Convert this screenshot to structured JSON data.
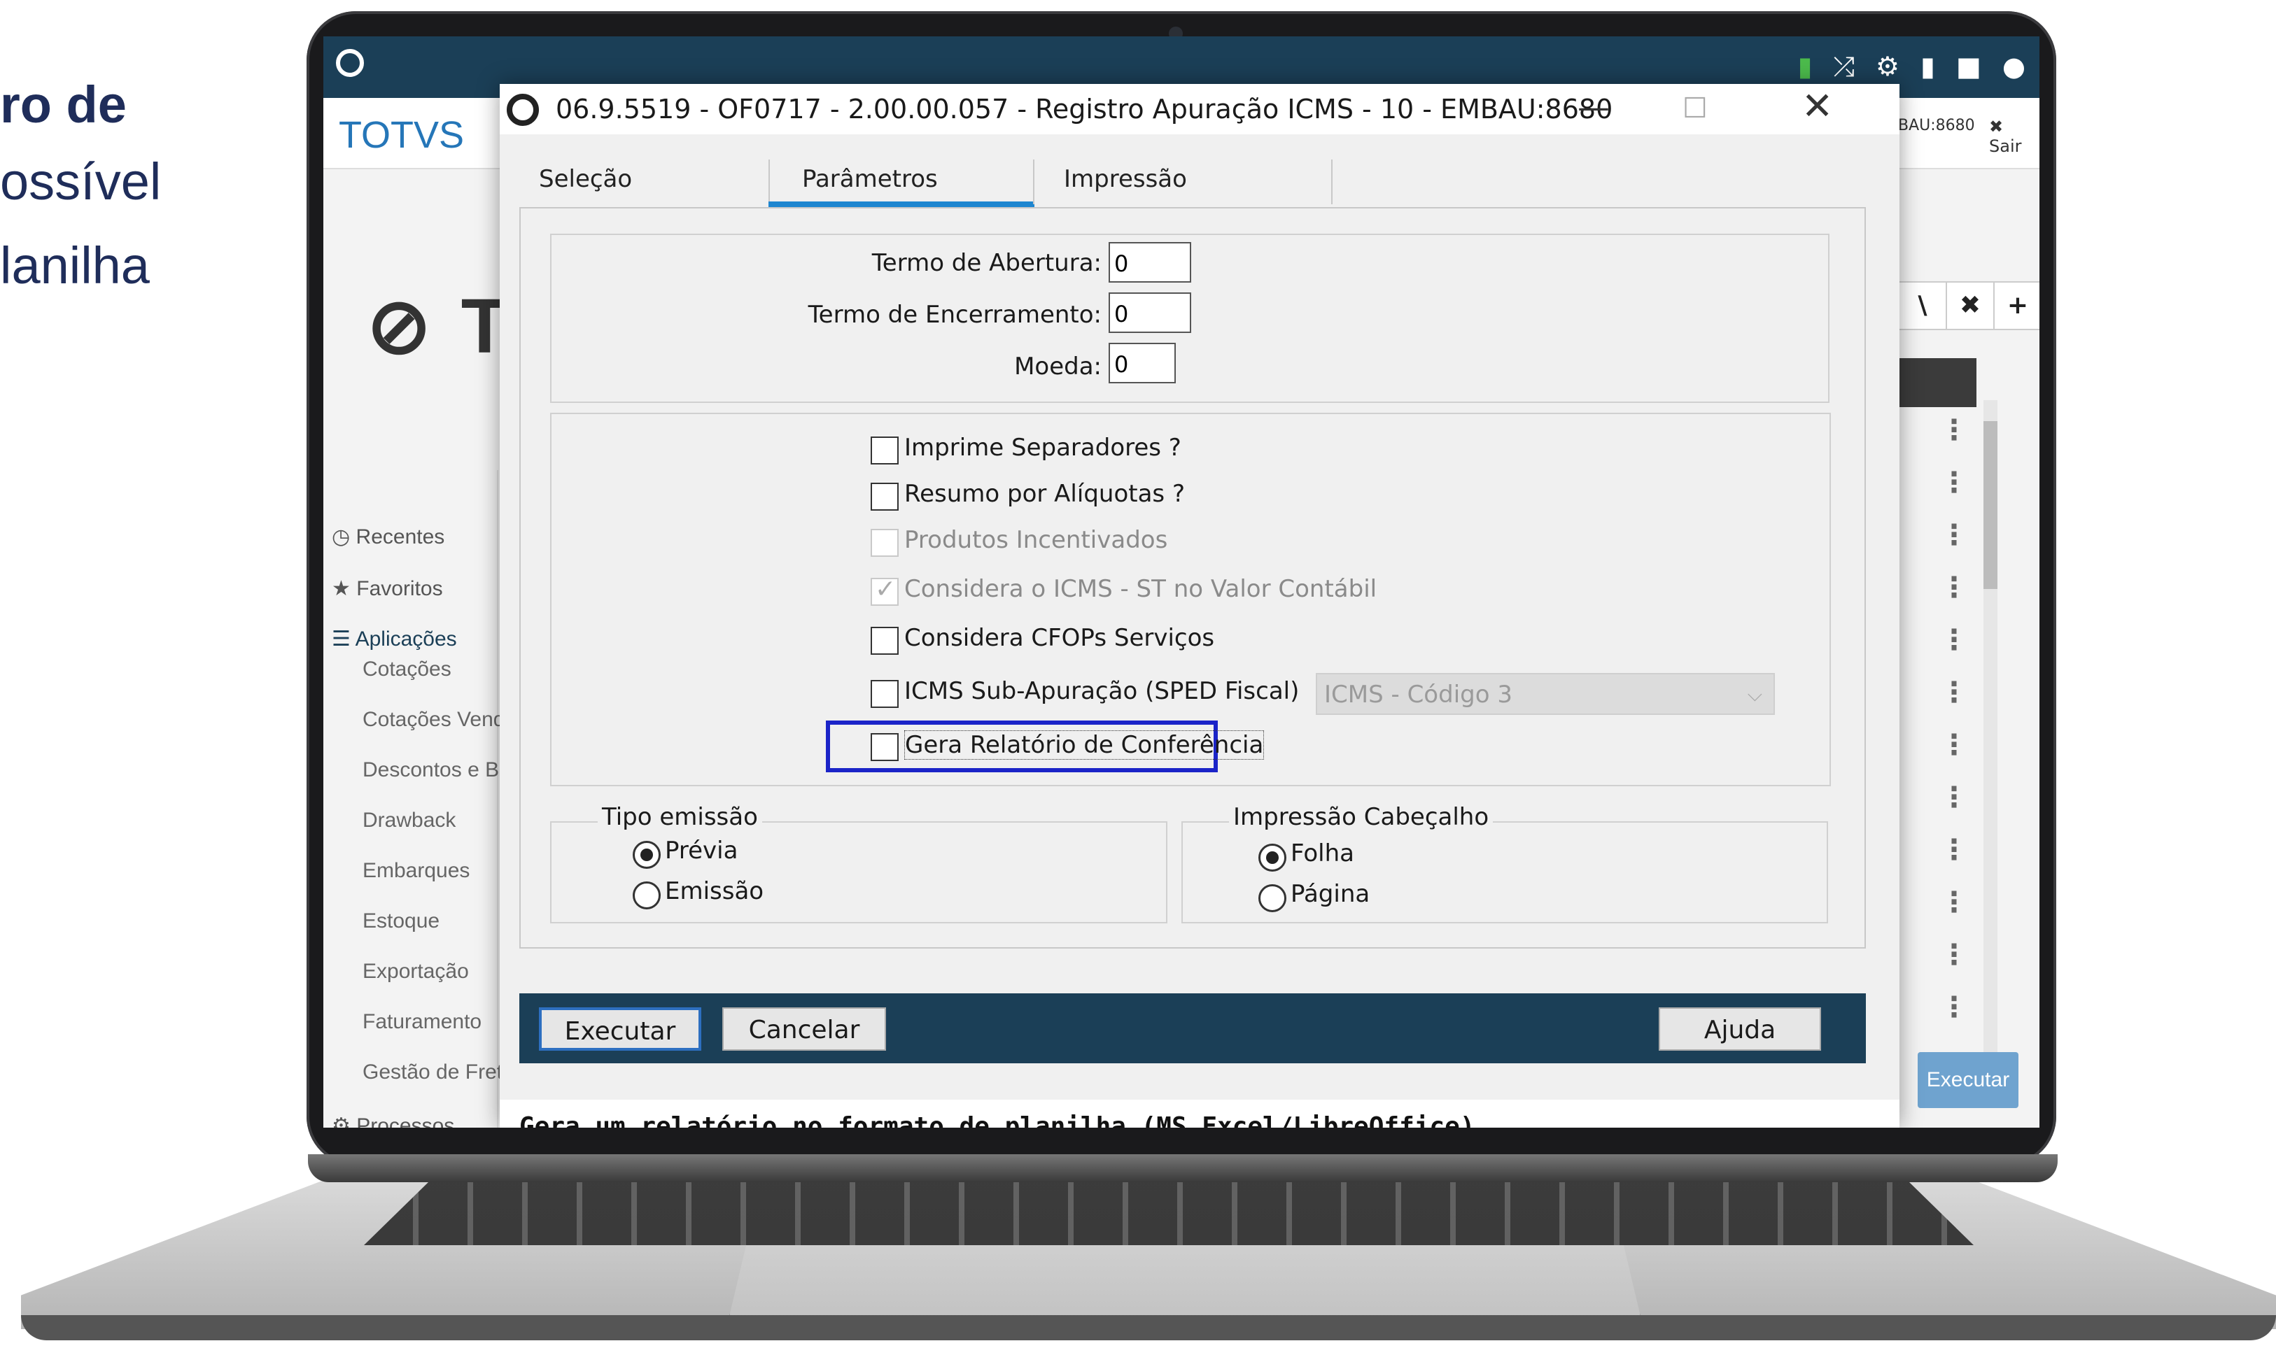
{
  "slide": {
    "line1": "ro de",
    "line2": "ossível",
    "line3": "lanilha"
  },
  "app": {
    "brand": "TOTVS",
    "big_logo": "TO",
    "header_right_env": "BAU:8680",
    "header_right_exit": "✖ Sair",
    "right_button_search": "\\",
    "right_button_close": "✖",
    "right_button_add": "+",
    "right_execute": "Executar",
    "topbar_icons": [
      "signal-bars-icon",
      "shuffle-icon",
      "gear-icon",
      "document-icon",
      "chat-icon",
      "help-icon"
    ],
    "sidebar": {
      "recentes": "Recentes",
      "favoritos": "Favoritos",
      "aplicacoes": "Aplicações",
      "processos": "Processos",
      "items": [
        "Cotações",
        "Cotações Vendas",
        "Descontos e Bon",
        "Drawback",
        "Embarques",
        "Estoque",
        "Exportação",
        "Faturamento",
        "Gestão de Frete"
      ]
    }
  },
  "dialog": {
    "title": "06.9.5519 - OF0717 - 2.00.00.057 - Registro Apuração ICMS - 10 - EMBAU:8680",
    "tabs": [
      "Seleção",
      "Parâmetros",
      "Impressão"
    ],
    "active_tab": "Parâmetros",
    "fields": {
      "termo_abertura_label": "Termo de Abertura:",
      "termo_abertura_value": "0",
      "termo_encerramento_label": "Termo de Encerramento:",
      "termo_encerramento_value": "0",
      "moeda_label": "Moeda:",
      "moeda_value": "0"
    },
    "checkboxes": [
      {
        "label": "Imprime Separadores ?",
        "checked": false,
        "disabled": false
      },
      {
        "label": "Resumo por Alíquotas ?",
        "checked": false,
        "disabled": false
      },
      {
        "label": "Produtos Incentivados",
        "checked": false,
        "disabled": true
      },
      {
        "label": "Considera o ICMS - ST no Valor Contábil",
        "checked": true,
        "disabled": true
      },
      {
        "label": "Considera CFOPs Serviços",
        "checked": false,
        "disabled": false
      },
      {
        "label": "ICMS Sub-Apuração (SPED Fiscal)",
        "checked": false,
        "disabled": false
      },
      {
        "label": "Gera Relatório de Conferência",
        "checked": false,
        "disabled": false
      }
    ],
    "icms_combo_value": "ICMS - Código 3",
    "tipo_emissao": {
      "legend": "Tipo emissão",
      "options": [
        "Prévia",
        "Emissão"
      ],
      "selected": "Prévia"
    },
    "impressao_cabecalho": {
      "legend": "Impressão Cabeçalho",
      "options": [
        "Folha",
        "Página"
      ],
      "selected": "Folha"
    },
    "buttons": {
      "execute": "Executar",
      "cancel": "Cancelar",
      "help": "Ajuda"
    },
    "status_text": "Gera um relatório no formato de planilha (MS Excel/LibreOffice)",
    "focus_color": "#1b24c8"
  }
}
